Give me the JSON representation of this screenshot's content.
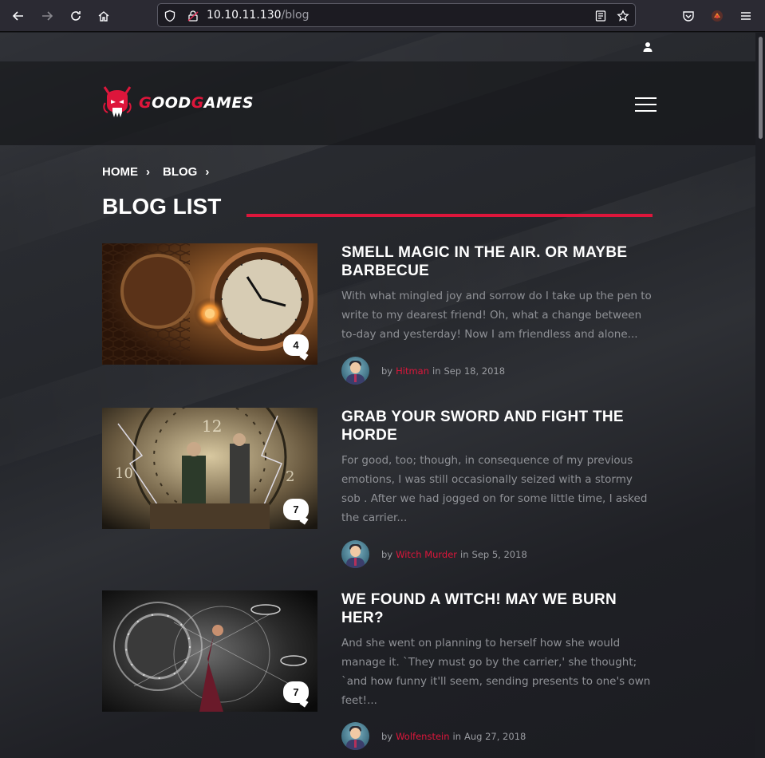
{
  "browser": {
    "url_host": "10.10.11.130",
    "url_path": "/blog"
  },
  "site": {
    "logo_text_prefix": "G",
    "logo_text_mid": "OOD",
    "logo_text_g2": "G",
    "logo_text_suffix": "AMES"
  },
  "breadcrumb": [
    {
      "label": "HOME"
    },
    {
      "label": "BLOG"
    }
  ],
  "page_title": "BLOG LIST",
  "posts": [
    {
      "title": "SMELL MAGIC IN THE AIR. OR MAYBE BARBECUE",
      "excerpt": "With what mingled joy and sorrow do I take up the pen to write to my dearest friend! Oh, what a change between to-day and yesterday! Now I am friendless and alone...",
      "comments": "4",
      "by": "by",
      "author": "Hitman",
      "in": "in",
      "date": "Sep 18, 2018"
    },
    {
      "title": "GRAB YOUR SWORD AND FIGHT THE HORDE",
      "excerpt": "For good, too; though, in consequence of my previous emotions, I was still occasionally seized with a stormy sob . After we had jogged on for some little time, I asked the carrier...",
      "comments": "7",
      "by": "by",
      "author": "Witch Murder",
      "in": "in",
      "date": "Sep 5, 2018"
    },
    {
      "title": "WE FOUND A WITCH! MAY WE BURN HER?",
      "excerpt": "And she went on planning to herself how she would manage it. `They must go by the carrier,' she thought; `and how funny it'll seem, sending presents to one's own feet!...",
      "comments": "7",
      "by": "by",
      "author": "Wolfenstein",
      "in": "in",
      "date": "Aug 27, 2018"
    }
  ],
  "colors": {
    "accent": "#dd163b",
    "text_muted": "#8f9196"
  }
}
